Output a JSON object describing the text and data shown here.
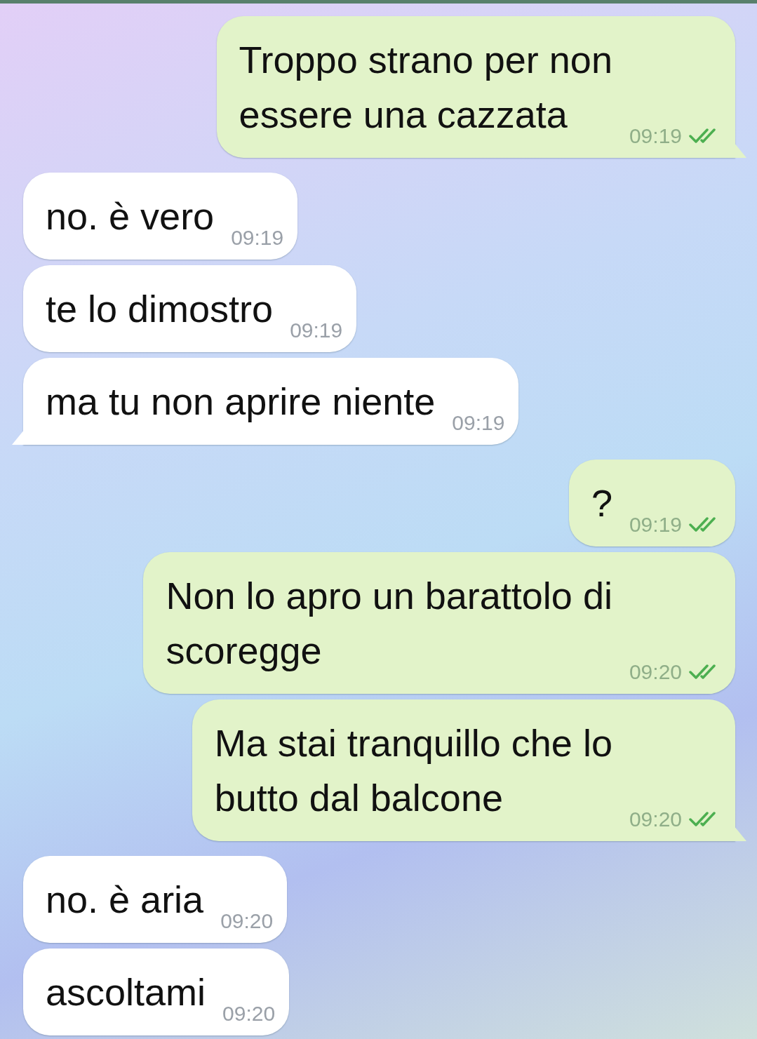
{
  "messages": [
    {
      "kind": "outgoing",
      "lines": [
        "Troppo strano per non",
        "essere una cazzata"
      ],
      "time": "09:19",
      "read": true,
      "tail": true
    },
    {
      "kind": "incoming",
      "lines": [
        "no. è vero"
      ],
      "time": "09:19",
      "tail": false
    },
    {
      "kind": "incoming",
      "lines": [
        "te lo dimostro"
      ],
      "time": "09:19",
      "tail": false
    },
    {
      "kind": "incoming",
      "lines": [
        "ma tu non aprire niente"
      ],
      "time": "09:19",
      "tail": true
    },
    {
      "kind": "outgoing",
      "lines": [
        "?"
      ],
      "time": "09:19",
      "read": true,
      "tail": false
    },
    {
      "kind": "outgoing",
      "lines": [
        "Non lo apro un barattolo di",
        "scoregge"
      ],
      "time": "09:20",
      "read": true,
      "tail": false
    },
    {
      "kind": "outgoing",
      "lines": [
        "Ma stai tranquillo che lo",
        "butto dal balcone"
      ],
      "time": "09:20",
      "read": true,
      "tail": true
    },
    {
      "kind": "incoming",
      "lines": [
        "no. è aria"
      ],
      "time": "09:20",
      "tail": false
    },
    {
      "kind": "incoming",
      "lines": [
        "ascoltami"
      ],
      "time": "09:20",
      "tail": false
    }
  ]
}
